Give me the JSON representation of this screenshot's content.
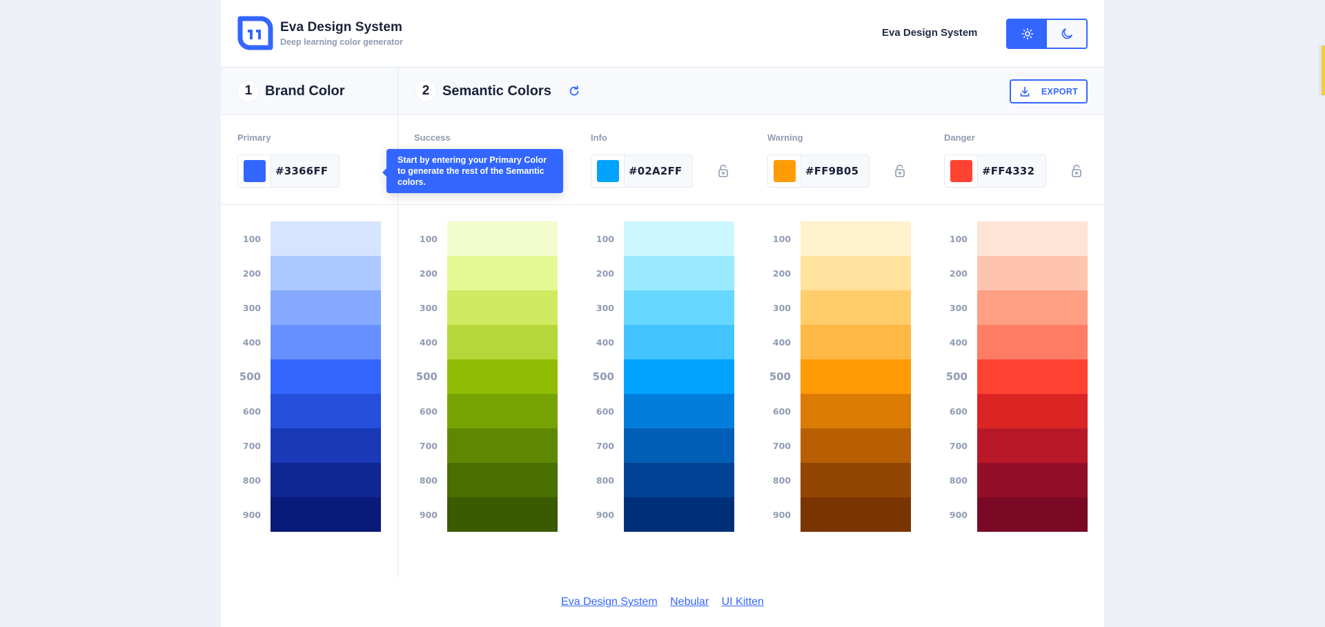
{
  "header": {
    "title": "Eva Design System",
    "subtitle": "Deep learning color generator",
    "right_link": "Eva Design System",
    "theme_toggle": {
      "options": [
        {
          "name": "light",
          "icon": "sun-icon",
          "active": true
        },
        {
          "name": "dark",
          "icon": "moon-icon",
          "active": false
        }
      ]
    }
  },
  "steps": {
    "brand": {
      "number": "1",
      "title": "Brand Color"
    },
    "semantic": {
      "number": "2",
      "title": "Semantic Colors",
      "refresh_icon": "refresh-icon"
    }
  },
  "export_button": {
    "label": "EXPORT",
    "icon": "download-icon"
  },
  "tooltip": {
    "text": "Start by entering your Primary Color to generate the rest of the Semantic colors."
  },
  "accent_color": "#3366FF",
  "colors": [
    {
      "key": "primary",
      "label": "Primary",
      "value": "#3366FF",
      "lockable": false,
      "shades": [
        {
          "label": "100",
          "hex": "#D6E4FF"
        },
        {
          "label": "200",
          "hex": "#ADC8FF"
        },
        {
          "label": "300",
          "hex": "#84A9FF"
        },
        {
          "label": "400",
          "hex": "#6690FF"
        },
        {
          "label": "500",
          "hex": "#3366FF"
        },
        {
          "label": "600",
          "hex": "#254EDB"
        },
        {
          "label": "700",
          "hex": "#1939B7"
        },
        {
          "label": "800",
          "hex": "#102693"
        },
        {
          "label": "900",
          "hex": "#091A7A"
        }
      ]
    },
    {
      "key": "success",
      "label": "Success",
      "value": "",
      "lockable": true,
      "shades": [
        {
          "label": "100",
          "hex": "#F2FBCC"
        },
        {
          "label": "200",
          "hex": "#E5F895"
        },
        {
          "label": "300",
          "hex": "#D0EB61"
        },
        {
          "label": "400",
          "hex": "#B5D73A"
        },
        {
          "label": "500",
          "hex": "#91BE04"
        },
        {
          "label": "600",
          "hex": "#77A302"
        },
        {
          "label": "700",
          "hex": "#5F8802"
        },
        {
          "label": "800",
          "hex": "#496E01"
        },
        {
          "label": "900",
          "hex": "#3A5B00"
        }
      ]
    },
    {
      "key": "info",
      "label": "Info",
      "value": "#02A2FF",
      "lockable": true,
      "shades": [
        {
          "label": "100",
          "hex": "#CCF7FF"
        },
        {
          "label": "200",
          "hex": "#99EAFF"
        },
        {
          "label": "300",
          "hex": "#66D7FF"
        },
        {
          "label": "400",
          "hex": "#41C4FF"
        },
        {
          "label": "500",
          "hex": "#02A2FF"
        },
        {
          "label": "600",
          "hex": "#017EDB"
        },
        {
          "label": "700",
          "hex": "#015EB7"
        },
        {
          "label": "800",
          "hex": "#004293"
        },
        {
          "label": "900",
          "hex": "#002F7A"
        }
      ]
    },
    {
      "key": "warning",
      "label": "Warning",
      "value": "#FF9B05",
      "lockable": true,
      "shades": [
        {
          "label": "100",
          "hex": "#FFF2CD"
        },
        {
          "label": "200",
          "hex": "#FFE29B"
        },
        {
          "label": "300",
          "hex": "#FFCD69"
        },
        {
          "label": "400",
          "hex": "#FFB844"
        },
        {
          "label": "500",
          "hex": "#FF9B05"
        },
        {
          "label": "600",
          "hex": "#DB7B03"
        },
        {
          "label": "700",
          "hex": "#B75F02"
        },
        {
          "label": "800",
          "hex": "#934601"
        },
        {
          "label": "900",
          "hex": "#7A3400"
        }
      ]
    },
    {
      "key": "danger",
      "label": "Danger",
      "value": "#FF4332",
      "lockable": true,
      "shades": [
        {
          "label": "100",
          "hex": "#FFE4D6"
        },
        {
          "label": "200",
          "hex": "#FFC4AD"
        },
        {
          "label": "300",
          "hex": "#FF9F84"
        },
        {
          "label": "400",
          "hex": "#FF7C65"
        },
        {
          "label": "500",
          "hex": "#FF4332"
        },
        {
          "label": "600",
          "hex": "#DB2424"
        },
        {
          "label": "700",
          "hex": "#B71929"
        },
        {
          "label": "800",
          "hex": "#930F27"
        },
        {
          "label": "900",
          "hex": "#7A0926"
        }
      ]
    }
  ],
  "footer": {
    "links": [
      "Eva Design System",
      "Nebular",
      "UI Kitten"
    ]
  }
}
